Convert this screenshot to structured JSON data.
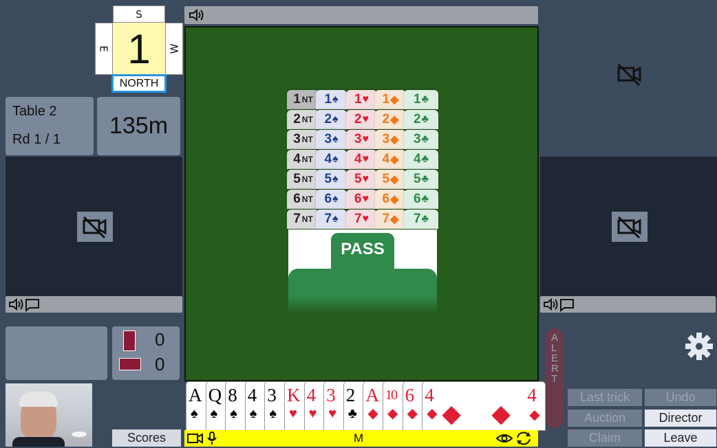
{
  "compass": {
    "south": "S",
    "east": "E",
    "west": "W",
    "number": "1",
    "north": "NORTH"
  },
  "table_info": {
    "table": "Table 2",
    "round": "Rd 1 / 1",
    "time": "135m"
  },
  "score": {
    "vul_top": "0",
    "vul_bottom": "0"
  },
  "scores_button": "Scores",
  "bidding": {
    "levels": [
      "1",
      "2",
      "3",
      "4",
      "5",
      "6",
      "7"
    ],
    "nt_label": "NT",
    "suits": [
      {
        "symbol": "♠",
        "color": "#1f3f98"
      },
      {
        "symbol": "♥",
        "color": "#e01d33"
      },
      {
        "symbol": "◆",
        "color": "#f07a1a"
      },
      {
        "symbol": "♣",
        "color": "#2f8a4c"
      }
    ],
    "pass_label": "PASS"
  },
  "hand": {
    "cards": [
      {
        "rank": "A",
        "suit": "♠",
        "color": "#000"
      },
      {
        "rank": "Q",
        "suit": "♠",
        "color": "#000"
      },
      {
        "rank": "8",
        "suit": "♠",
        "color": "#000"
      },
      {
        "rank": "4",
        "suit": "♠",
        "color": "#000"
      },
      {
        "rank": "3",
        "suit": "♠",
        "color": "#000"
      },
      {
        "rank": "K",
        "suit": "♥",
        "color": "#e01d33"
      },
      {
        "rank": "4",
        "suit": "♥",
        "color": "#e01d33"
      },
      {
        "rank": "3",
        "suit": "♥",
        "color": "#e01d33"
      },
      {
        "rank": "2",
        "suit": "♣",
        "color": "#000"
      },
      {
        "rank": "A",
        "suit": "◆",
        "color": "#e01d33"
      },
      {
        "rank": "10",
        "suit": "◆",
        "color": "#e01d33"
      },
      {
        "rank": "6",
        "suit": "◆",
        "color": "#e01d33"
      },
      {
        "rank": "4",
        "suit": "◆",
        "color": "#e01d33"
      }
    ],
    "last_card_corner_rank": "4",
    "last_card_corner_suit": "◆"
  },
  "player_bar": {
    "label": "M",
    "color": "#ffff00"
  },
  "alert_label": "ALERT",
  "controls": {
    "last_trick": "Last trick",
    "undo": "Undo",
    "auction": "Auction",
    "director": "Director",
    "claim": "Claim",
    "leave": "Leave"
  },
  "icons": {
    "speaker": "speaker-icon",
    "chat": "chat-icon",
    "camera_off": "camera-off-icon",
    "gear": "gear-icon",
    "video": "video-icon",
    "mic": "mic-icon",
    "eye": "eye-icon",
    "refresh": "refresh-icon"
  }
}
